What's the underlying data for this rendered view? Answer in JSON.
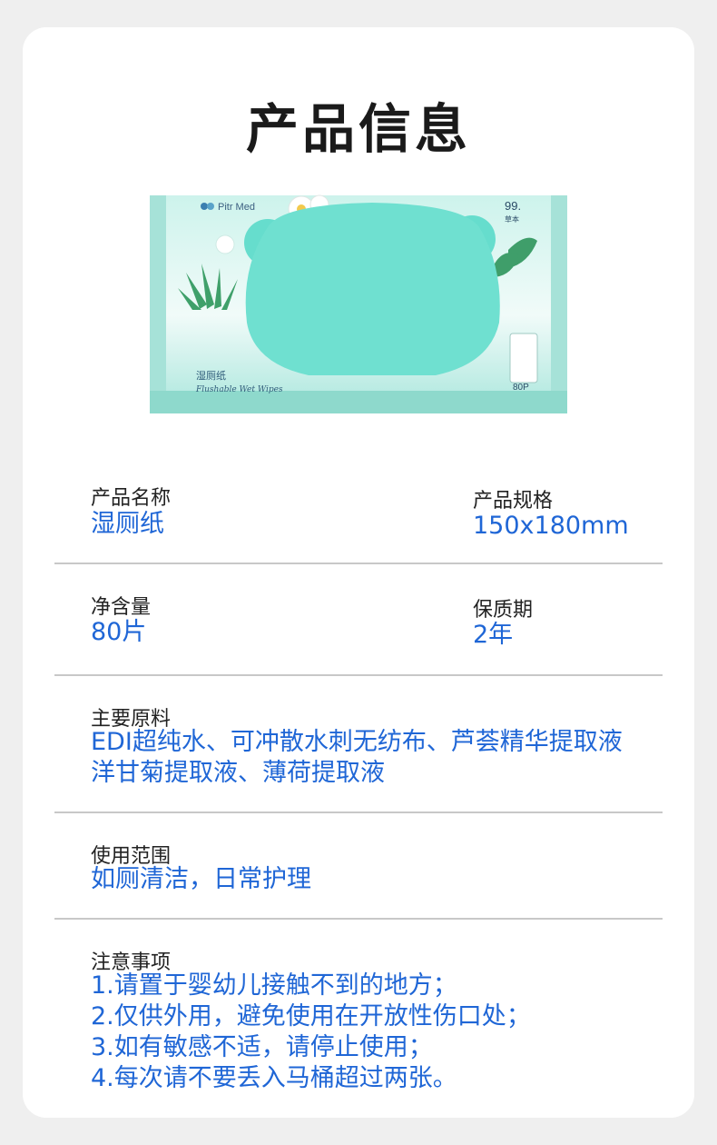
{
  "page_title": "产品信息",
  "product_image": {
    "brand": "Pitr Med",
    "name_cn": "湿厕纸",
    "name_en": "Flushable Wet Wipes",
    "corner_mark": "99.",
    "corner_sub": "草本",
    "count_mark": "80P",
    "colors": {
      "package": "#bfeee6",
      "lid": "#6fe0d0",
      "leaf": "#3fa06a"
    }
  },
  "fields": {
    "product_name": {
      "label": "产品名称",
      "value": "湿厕纸"
    },
    "spec": {
      "label": "产品规格",
      "value": "150x180mm"
    },
    "net_content": {
      "label": "净含量",
      "value": "80片"
    },
    "shelf_life": {
      "label": "保质期",
      "value": "2年"
    },
    "ingredients": {
      "label": "主要原料",
      "lines": [
        "EDI超纯水、可冲散水刺无纺布、芦荟精华提取液",
        "洋甘菊提取液、薄荷提取液"
      ]
    },
    "usage": {
      "label": "使用范围",
      "value": "如厕清洁，日常护理"
    },
    "notes": {
      "label": "注意事项",
      "lines": [
        "1.请置于婴幼儿接触不到的地方；",
        "2.仅供外用，避免使用在开放性伤口处；",
        "3.如有敏感不适，请停止使用；",
        "4.每次请不要丢入马桶超过两张。"
      ]
    }
  },
  "accent_color": "#1f66d6"
}
